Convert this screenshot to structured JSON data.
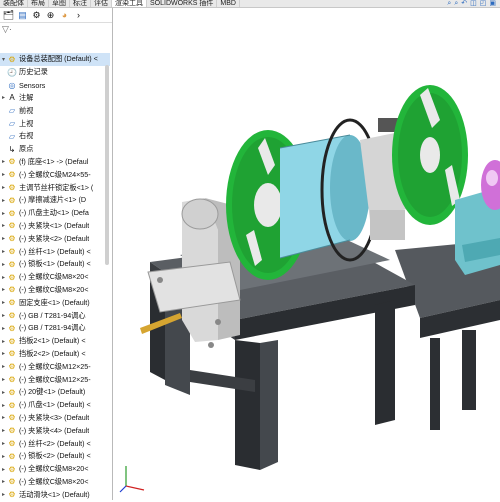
{
  "tabs": [
    "装配体",
    "布局",
    "草图",
    "标注",
    "评估",
    "渲染工具",
    "SOLIDWORKS 插件",
    "MBD"
  ],
  "active_tab": 5,
  "toolbar_icons": [
    "feature-manager-icon",
    "property-manager-icon",
    "config-manager-icon",
    "dimxpert-icon",
    "display-manager-icon"
  ],
  "tree": {
    "root": "设备总装配图 (Default) <",
    "items": [
      {
        "label": "历史记录",
        "icon": "history-icon",
        "toggle": ""
      },
      {
        "label": "Sensors",
        "icon": "sensors-icon",
        "toggle": ""
      },
      {
        "label": "注解",
        "icon": "annotations-icon",
        "toggle": "▸"
      },
      {
        "label": "前视",
        "icon": "plane-icon",
        "toggle": ""
      },
      {
        "label": "上视",
        "icon": "plane-icon",
        "toggle": ""
      },
      {
        "label": "右视",
        "icon": "plane-icon",
        "toggle": ""
      },
      {
        "label": "原点",
        "icon": "origin-icon",
        "toggle": ""
      },
      {
        "label": "(f) 底座<1> -> (Defaul",
        "icon": "part-icon",
        "toggle": "▸"
      },
      {
        "label": "(-) 全螺纹C级M24×55-",
        "icon": "part-icon",
        "toggle": "▸"
      },
      {
        "label": "主调节丝杆锁定板<1> (",
        "icon": "part-icon",
        "toggle": "▸"
      },
      {
        "label": "(-) 摩擦减速片<1> (D",
        "icon": "part-icon",
        "toggle": "▸"
      },
      {
        "label": "(-) 爪盘主动<1> (Defa",
        "icon": "part-icon",
        "toggle": "▸"
      },
      {
        "label": "(-) 夹紧块<1> (Default",
        "icon": "part-icon",
        "toggle": "▸"
      },
      {
        "label": "(-) 夹紧块<2> (Default",
        "icon": "part-icon",
        "toggle": "▸"
      },
      {
        "label": "(-) 丝杆<1> (Default) <",
        "icon": "part-icon",
        "toggle": "▸"
      },
      {
        "label": "(-) 锁板<1> (Default) <",
        "icon": "part-icon",
        "toggle": "▸"
      },
      {
        "label": "(-) 全螺纹C级M8×20<",
        "icon": "part-icon",
        "toggle": "▸"
      },
      {
        "label": "(-) 全螺纹C级M8×20<",
        "icon": "part-icon",
        "toggle": "▸"
      },
      {
        "label": "固定支座<1> (Default)",
        "icon": "part-icon",
        "toggle": "▸"
      },
      {
        "label": "(-) GB / T281-94调心",
        "icon": "part-icon",
        "toggle": "▸"
      },
      {
        "label": "(-) GB / T281-94调心",
        "icon": "part-icon",
        "toggle": "▸"
      },
      {
        "label": "挡板2<1> (Default) <",
        "icon": "part-icon",
        "toggle": "▸"
      },
      {
        "label": "挡板2<2> (Default) <",
        "icon": "part-icon",
        "toggle": "▸"
      },
      {
        "label": "(-) 全螺纹C级M12×25-",
        "icon": "part-icon",
        "toggle": "▸"
      },
      {
        "label": "(-) 全螺纹C级M12×25-",
        "icon": "part-icon",
        "toggle": "▸"
      },
      {
        "label": "(-) 20键<1> (Default)",
        "icon": "part-icon",
        "toggle": "▸"
      },
      {
        "label": "(-) 爪盘<1> (Default) <",
        "icon": "part-icon",
        "toggle": "▸"
      },
      {
        "label": "(-) 夹紧块<3> (Default",
        "icon": "part-icon",
        "toggle": "▸"
      },
      {
        "label": "(-) 夹紧块<4> (Default",
        "icon": "part-icon",
        "toggle": "▸"
      },
      {
        "label": "(-) 丝杆<2> (Default) <",
        "icon": "part-icon",
        "toggle": "▸"
      },
      {
        "label": "(-) 锁板<2> (Default) <",
        "icon": "part-icon",
        "toggle": "▸"
      },
      {
        "label": "(-) 全螺纹C级M8×20<",
        "icon": "part-icon",
        "toggle": "▸"
      },
      {
        "label": "(-) 全螺纹C级M8×20<",
        "icon": "part-icon",
        "toggle": "▸"
      },
      {
        "label": "活动滑块<1> (Default)",
        "icon": "part-icon",
        "toggle": "▸"
      }
    ]
  },
  "colors": {
    "accent": "#2d6bbf",
    "flange": "#22b53a",
    "drum": "#8fd6e6",
    "base": "#3a3d42",
    "steel": "#c9c9c9",
    "teal": "#6fc2cc",
    "brass": "#d6a531",
    "magenta": "#d070d8"
  }
}
